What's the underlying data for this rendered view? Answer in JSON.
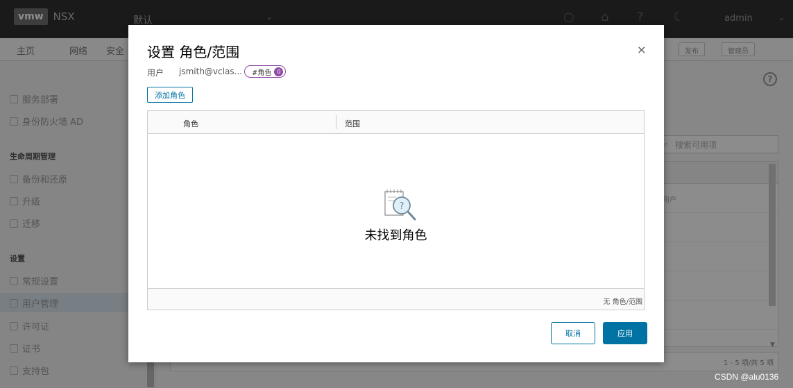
{
  "app": {
    "logo": "vmw",
    "product": "NSX",
    "context": "默认",
    "user": "admin"
  },
  "nav": {
    "items": [
      "主页",
      "网络",
      "安全"
    ],
    "buttons": [
      "发布",
      "管理员"
    ]
  },
  "sidebar": {
    "items_top": [
      "服务部署",
      "身份防火墙 AD"
    ],
    "section_lifecycle": "生命周期管理",
    "items_lifecycle": [
      "备份和还原",
      "升级",
      "迁移"
    ],
    "section_settings": "设置",
    "items_settings": [
      "常规设置",
      "用户管理",
      "许可证",
      "证书",
      "支持包"
    ]
  },
  "background": {
    "search_placeholder": "搜索可用项",
    "row_text": "用户",
    "pagination": "1 - 5 项/共 5 项"
  },
  "modal": {
    "title": "设置 角色/范围",
    "close_glyph": "×",
    "user_label": "用户",
    "user_value": "jsmith@vclas...",
    "role_pill_label": "#角色",
    "role_pill_count": "0",
    "add_role_button": "添加角色",
    "grid": {
      "columns": [
        "角色",
        "范围"
      ],
      "empty_text": "未找到角色",
      "footer": "无 角色/范围"
    },
    "cancel_button": "取消",
    "apply_button": "应用"
  },
  "watermark": "CSDN @alu0136",
  "colors": {
    "primary": "#0072a3",
    "pill_accent": "#8f4aa6",
    "header_bg": "#313131"
  }
}
